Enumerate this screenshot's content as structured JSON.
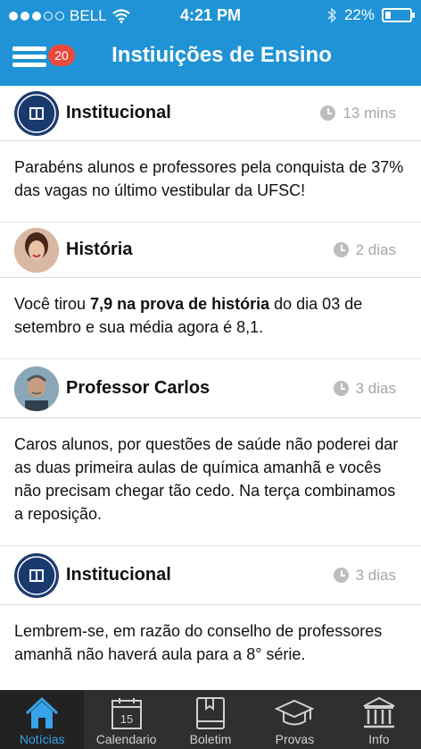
{
  "status_bar": {
    "carrier": "BELL",
    "time": "4:21 PM",
    "battery_percent": "22%",
    "battery_level": 0.22,
    "signal_filled": 3,
    "signal_total": 5
  },
  "header": {
    "title": "Instiuições de Ensino",
    "notification_count": "20"
  },
  "posts": [
    {
      "author": "Institucional",
      "time": "13 mins",
      "avatar": "university-seal-icon",
      "body": "Parabéns alunos e professores pela conquista de 37% das vagas no último vestibular da UFSC!"
    },
    {
      "author": "História",
      "time": "2 dias",
      "avatar": "user-photo",
      "body_parts": [
        "Você tirou ",
        "7,9 na prova de história",
        " do dia 03 de setembro e sua média agora é 8,1."
      ]
    },
    {
      "author": "Professor Carlos",
      "time": "3 dias",
      "avatar": "user-photo",
      "body": "Caros alunos, por questões de saúde não poderei dar as duas primeira aulas de química amanhã e vocês não precisam chegar tão cedo. Na terça combinamos a reposição."
    },
    {
      "author": "Institucional",
      "time": "3 dias",
      "avatar": "university-seal-icon",
      "body": "Lembrem-se, em razão do conselho de professores amanhã não haverá aula para a 8° série."
    }
  ],
  "tabs": [
    {
      "label": "Notícias",
      "icon": "home-icon",
      "active": true
    },
    {
      "label": "Calendario",
      "icon": "calendar-icon",
      "calendar_day": "15"
    },
    {
      "label": "Boletim",
      "icon": "book-icon"
    },
    {
      "label": "Provas",
      "icon": "graduation-cap-icon"
    },
    {
      "label": "Info",
      "icon": "institution-icon"
    }
  ],
  "colors": {
    "header_bg": "#1f93d5",
    "badge": "#e84a3d",
    "tab_active": "#37a3e8",
    "tabbar_bg": "#2f2f2f"
  }
}
